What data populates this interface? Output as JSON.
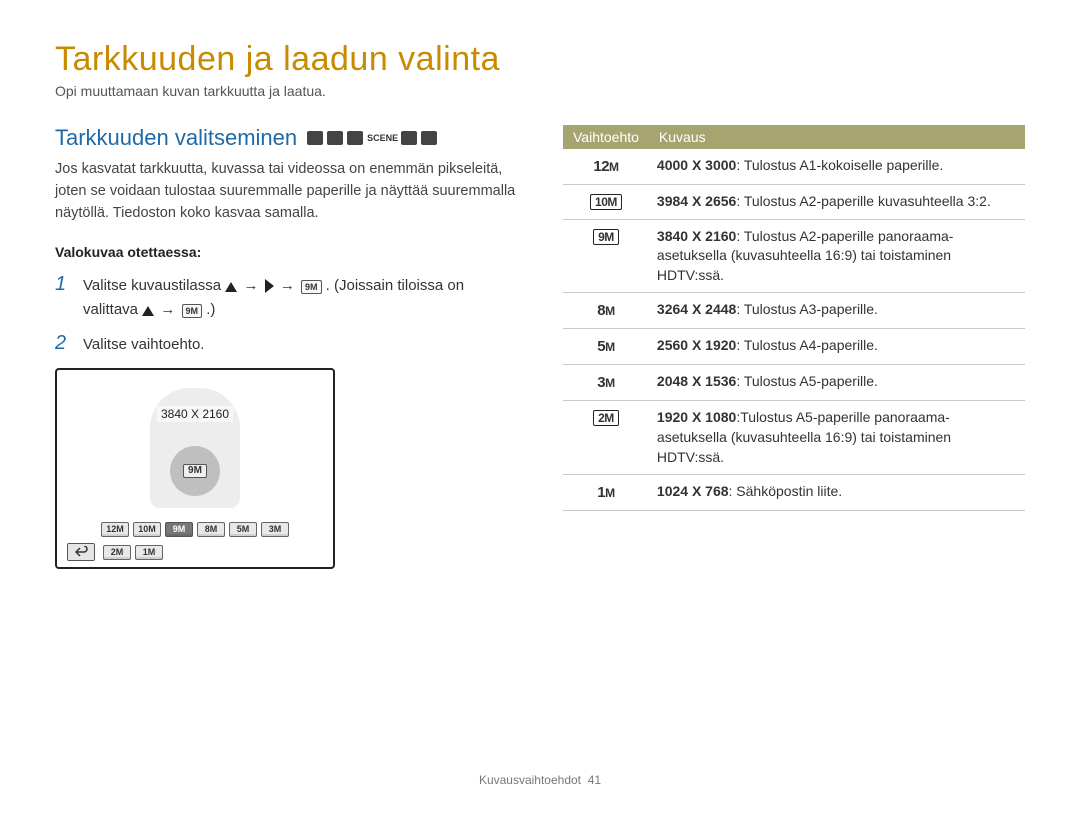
{
  "page": {
    "title": "Tarkkuuden ja laadun valinta",
    "intro": "Opi muuttamaan kuvan tarkkuutta ja laatua."
  },
  "section": {
    "heading": "Tarkkuuden valitseminen",
    "mode_icons": [
      "camera-icon",
      "camera-icon",
      "camera-icon",
      "scene-icon",
      "hand-icon",
      "video-icon"
    ],
    "scene_label": "SCENE",
    "description": "Jos kasvatat tarkkuutta, kuvassa tai videossa on enemmän pikseleitä, joten se voidaan tulostaa suuremmalle paperille ja näyttää suuremmalla näytöllä. Tiedoston koko kasvaa samalla.",
    "subhead": "Valokuvaa otettaessa:",
    "steps": {
      "s1a": "Valitse kuvaustilassa ",
      "s1b": ". (Joissain tiloissa on valittava ",
      "s1c": ".)",
      "s2": "Valitse vaihtoehto."
    }
  },
  "preview": {
    "current_label": "3840 X 2160",
    "center_badge": "9M",
    "row1": [
      "12M",
      "10M",
      "9M",
      "8M",
      "5M",
      "3M"
    ],
    "row2": [
      "2M",
      "1M"
    ],
    "selected_index": 2
  },
  "table": {
    "head_option": "Vaihtoehto",
    "head_desc": "Kuvaus",
    "rows": [
      {
        "symbol": "12M",
        "boxed": false,
        "res": "4000 X 3000",
        "desc": ": Tulostus A1-kokoiselle paperille."
      },
      {
        "symbol": "10M",
        "boxed": true,
        "res": "3984 X 2656",
        "desc": ": Tulostus A2-paperille kuvasuhteella 3:2."
      },
      {
        "symbol": "9M",
        "boxed": true,
        "res": "3840 X 2160",
        "desc": ": Tulostus A2-paperille panoraama-asetuksella (kuvasuhteella 16:9) tai toistaminen HDTV:ssä."
      },
      {
        "symbol": "8M",
        "boxed": false,
        "res": "3264 X 2448",
        "desc": ": Tulostus A3-paperille."
      },
      {
        "symbol": "5M",
        "boxed": false,
        "res": "2560 X 1920",
        "desc": ": Tulostus A4-paperille."
      },
      {
        "symbol": "3M",
        "boxed": false,
        "res": "2048 X 1536",
        "desc": ": Tulostus A5-paperille."
      },
      {
        "symbol": "2M",
        "boxed": true,
        "res": "1920 X 1080",
        "desc": ":Tulostus A5-paperille panoraama-asetuksella (kuvasuhteella 16:9) tai toistaminen HDTV:ssä."
      },
      {
        "symbol": "1M",
        "boxed": false,
        "res": "1024 X 768",
        "desc": ": Sähköpostin liite."
      }
    ]
  },
  "footer": {
    "section": "Kuvausvaihtoehdot",
    "page_number": "41"
  }
}
